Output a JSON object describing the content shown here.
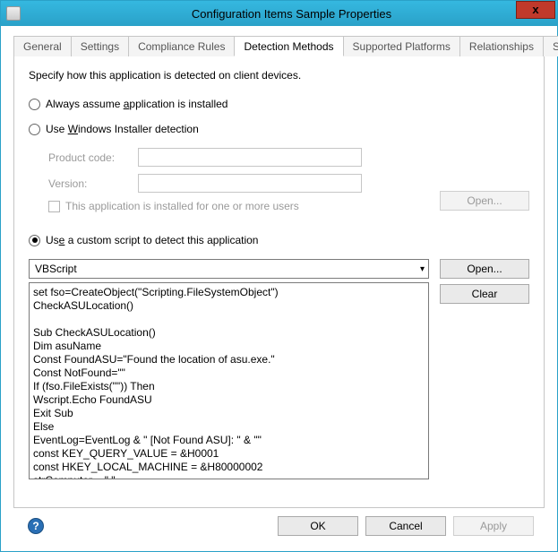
{
  "window": {
    "title": "Configuration Items Sample Properties"
  },
  "close_button": "x",
  "tabs": [
    {
      "label": "General"
    },
    {
      "label": "Settings"
    },
    {
      "label": "Compliance Rules"
    },
    {
      "label": "Detection Methods"
    },
    {
      "label": "Supported Platforms"
    },
    {
      "label": "Relationships"
    },
    {
      "label": "Security"
    }
  ],
  "active_tab_index": 3,
  "detection": {
    "intro": "Specify how this application is detected on client devices.",
    "radio": {
      "assume_label_pre": "Always assume ",
      "assume_label_mid": "a",
      "assume_label_post": "pplication is installed",
      "wininst_label_pre": "Use ",
      "wininst_label_mid": "W",
      "wininst_label_post": "indows Installer detection",
      "custom_label_pre": "Us",
      "custom_label_mid": "e",
      "custom_label_post": " a custom script to detect this application"
    },
    "selected_option": "custom",
    "wininst": {
      "product_code_label_pre": "P",
      "product_code_label_mid": "r",
      "product_code_label_post": "oduct code:",
      "version_label_pre": "",
      "version_label_mid": "V",
      "version_label_post": "ersion:",
      "product_code_value": "",
      "version_value": "",
      "multi_user_label_pre": "",
      "multi_user_label_mid": "T",
      "multi_user_label_post": "his application is installed for one or more users",
      "multi_user_checked": false,
      "open_label_pre": "",
      "open_label_mid": "O",
      "open_label_post": "pen..."
    },
    "custom": {
      "script_type": "VBScript",
      "open_label": "Open...",
      "clear_label_pre": "C",
      "clear_label_mid": "l",
      "clear_label_post": "ear",
      "script_body": "set fso=CreateObject(\"Scripting.FileSystemObject\")\nCheckASULocation()\n\nSub CheckASULocation()\nDim asuName\nConst FoundASU=\"Found the location of asu.exe.\"\nConst NotFound=\"\"\nIf (fso.FileExists(\"\")) Then\nWscript.Echo FoundASU\nExit Sub\nElse\nEventLog=EventLog & \" [Not Found ASU]: \" & \"\"\nconst KEY_QUERY_VALUE = &H0001\nconst HKEY_LOCAL_MACHINE = &H80000002\nstrComputer = \".\"\nSet oReg=GetObject(\"winmgmts:{impersonationLevel=impersonate}!\\\\\" &\nstrComputer & \"\\root\\default:StdRegProv\")"
    }
  },
  "buttons": {
    "ok": "OK",
    "cancel": "Cancel",
    "apply_pre": "",
    "apply_mid": "A",
    "apply_post": "pply"
  },
  "help": "?"
}
